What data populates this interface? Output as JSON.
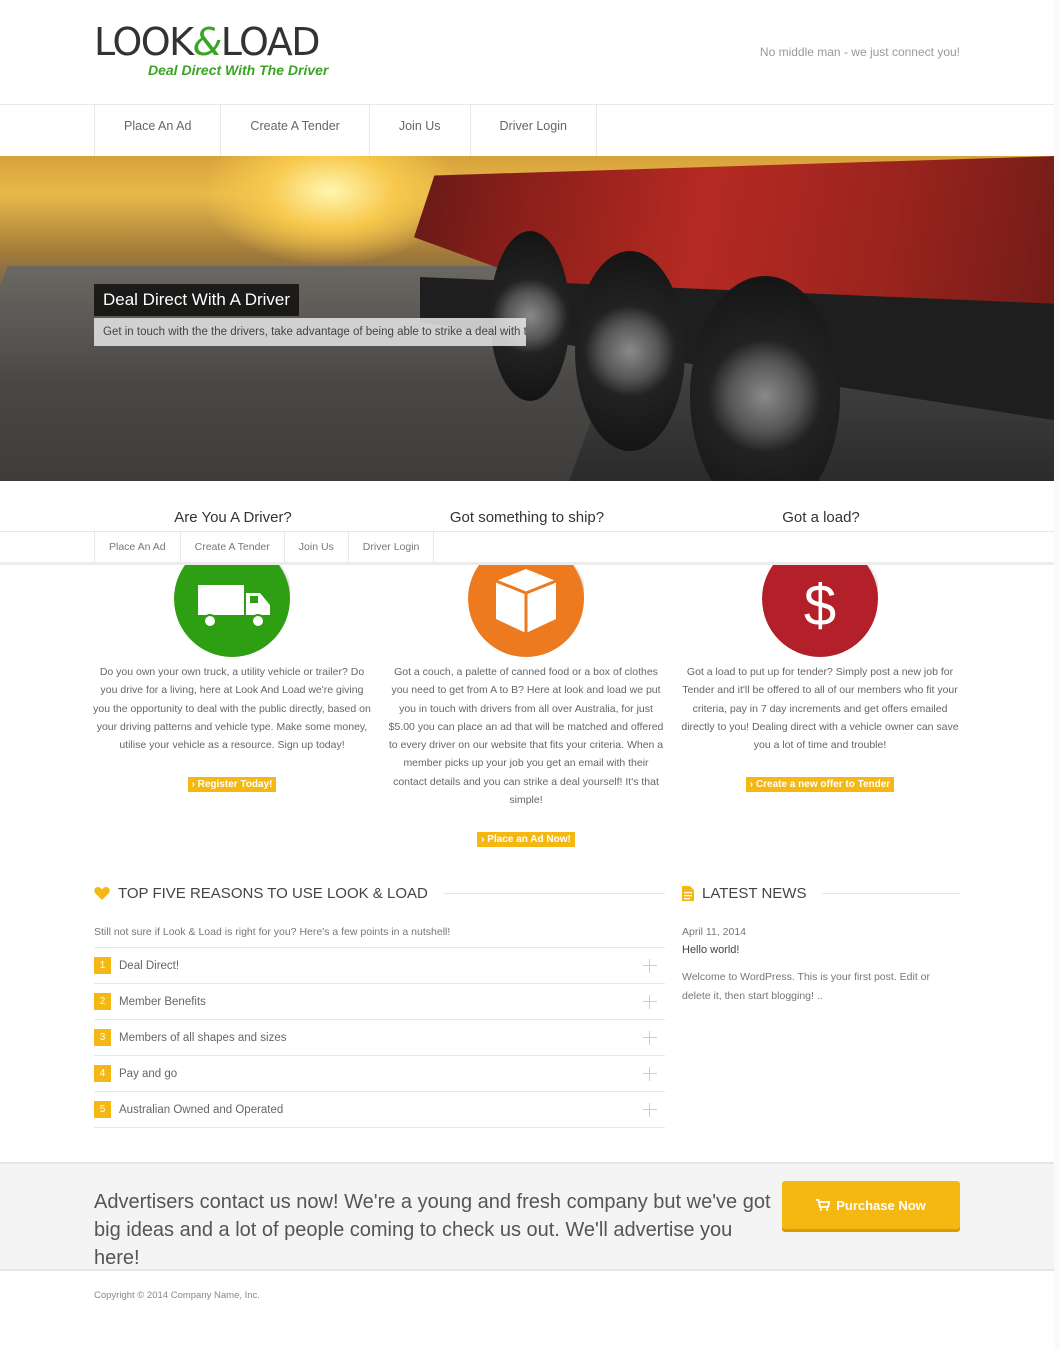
{
  "header": {
    "logo_text_1": "LOOK",
    "logo_amp": "&",
    "logo_text_2": "LOAD",
    "logo_tagline": "Deal Direct With The Driver",
    "tagline": "No middle man - we just connect you!"
  },
  "nav": {
    "items": [
      "Place An Ad",
      "Create A Tender",
      "Join Us",
      "Driver Login"
    ]
  },
  "hero": {
    "title": "Deal Direct With A Driver",
    "caption": "Get in touch with the the drivers, take advantage of being able to strike a deal with the driver"
  },
  "topics": {
    "driver_heading": "Are You A Driver?",
    "ship_heading": "Got something to ship?",
    "load_heading": "Got a load?"
  },
  "subnav": {
    "items": [
      "Place An Ad",
      "Create A Tender",
      "Join Us",
      "Driver Login"
    ]
  },
  "columns": [
    {
      "icon": "truck-icon",
      "color": "#2e9e12",
      "text": "Do you own your own truck, a utility vehicle or trailer? Do you drive for a living, here at Look And Load we're giving you the opportunity to deal with the public directly, based on your driving patterns and vehicle type. Make some money, utilise your vehicle as a resource. Sign up today!",
      "button": "› Register Today!"
    },
    {
      "icon": "box-icon",
      "color": "#ee7a1f",
      "text": "Got a couch, a palette of canned food or a box of clothes you need to get from A to B? Here at look and load we put you in touch with drivers from all over Australia, for just $5.00 you can place an ad that will be matched and offered to every driver on our website that fits your criteria. When a member picks up your job you get an email with their contact details and you can strike a deal yourself! It's that simple!",
      "button": "› Place an Ad Now!"
    },
    {
      "icon": "dollar-icon",
      "color": "#b3202a",
      "text": "Got a load to put up for tender? Simply post a new job for Tender and it'll be offered to all of our members who fit your criteria, pay in 7 day increments and get offers emailed directly to you! Dealing direct with a vehicle owner can save you a lot of time and trouble!",
      "button": "› Create a new offer to Tender"
    }
  ],
  "reasons": {
    "heading": "TOP FIVE REASONS TO USE LOOK & LOAD",
    "intro": "Still not sure if Look & Load is right for you? Here's a few points in a nutshell!",
    "items": [
      {
        "num": "1",
        "label": "Deal Direct!"
      },
      {
        "num": "2",
        "label": "Member Benefits"
      },
      {
        "num": "3",
        "label": "Members of all shapes and sizes"
      },
      {
        "num": "4",
        "label": "Pay and go"
      },
      {
        "num": "5",
        "label": "Australian Owned and Operated"
      }
    ]
  },
  "news": {
    "heading": "LATEST NEWS",
    "date": "April 11, 2014",
    "title": "Hello world!",
    "text": "Welcome to WordPress. This is your first post. Edit or delete it, then start blogging! .."
  },
  "cta": {
    "text": "Advertisers contact us now! We're a young and fresh company but we've got big ideas and a lot of people coming to check us out. We'll advertise you here!",
    "button": "Purchase Now"
  },
  "footer": {
    "copyright": "Copyright © 2014 Company Name, Inc."
  },
  "colors": {
    "accent": "#f5b712",
    "brand_green": "#3aa524"
  }
}
